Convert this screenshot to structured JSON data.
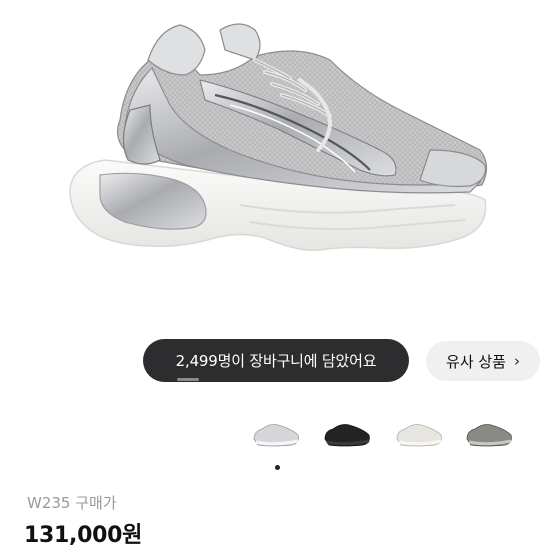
{
  "hero": {
    "image_alt": "sneaker-photo",
    "colors": {
      "mesh": "#c9c9ca",
      "silver": "#b7b9bc",
      "sole": "#f4f4f2",
      "outline": "#6c6c70"
    }
  },
  "cart_banner": {
    "text": "2,499명이 장바구니에 담았어요"
  },
  "similar_button": {
    "label": "유사 상품",
    "chevron": "›"
  },
  "thumbnails": [
    {
      "name": "silver-white",
      "color": "#c9cbce"
    },
    {
      "name": "black",
      "color": "#222325"
    },
    {
      "name": "cream-white",
      "color": "#e4e1da"
    },
    {
      "name": "gray",
      "color": "#7a7a75"
    }
  ],
  "product": {
    "name": "W235 구매가",
    "price": "131,000원"
  }
}
